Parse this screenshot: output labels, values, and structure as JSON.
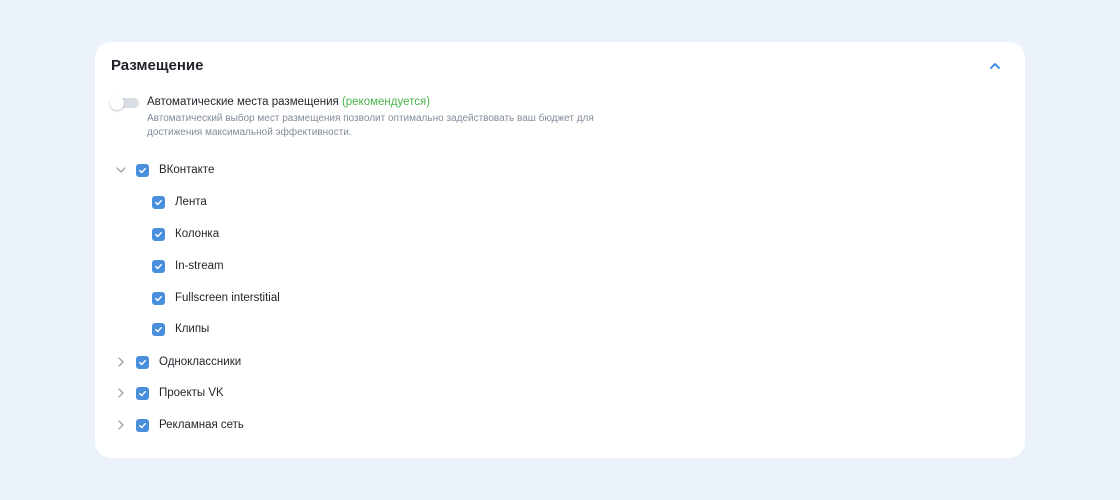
{
  "section": {
    "title": "Размещение"
  },
  "auto_placement": {
    "label": "Автоматические места размещения",
    "recommended": "(рекомендуется)",
    "description": "Автоматический выбор мест размещения позволит оптимально задействовать ваш бюджет для достижения максимальной эффективности.",
    "enabled": false
  },
  "platforms": [
    {
      "label": "ВКонтакте",
      "expanded": true,
      "checked": true,
      "children": [
        {
          "label": "Лента",
          "checked": true
        },
        {
          "label": "Колонка",
          "checked": true
        },
        {
          "label": "In-stream",
          "checked": true
        },
        {
          "label": "Fullscreen interstitial",
          "checked": true
        },
        {
          "label": "Клипы",
          "checked": true
        }
      ]
    },
    {
      "label": "Одноклассники",
      "expanded": false,
      "checked": true
    },
    {
      "label": "Проекты VK",
      "expanded": false,
      "checked": true
    },
    {
      "label": "Рекламная сеть",
      "expanded": false,
      "checked": true
    }
  ],
  "colors": {
    "accent": "#4a8fdb",
    "recommended": "#4bb34b",
    "background": "#ebf2f9"
  }
}
